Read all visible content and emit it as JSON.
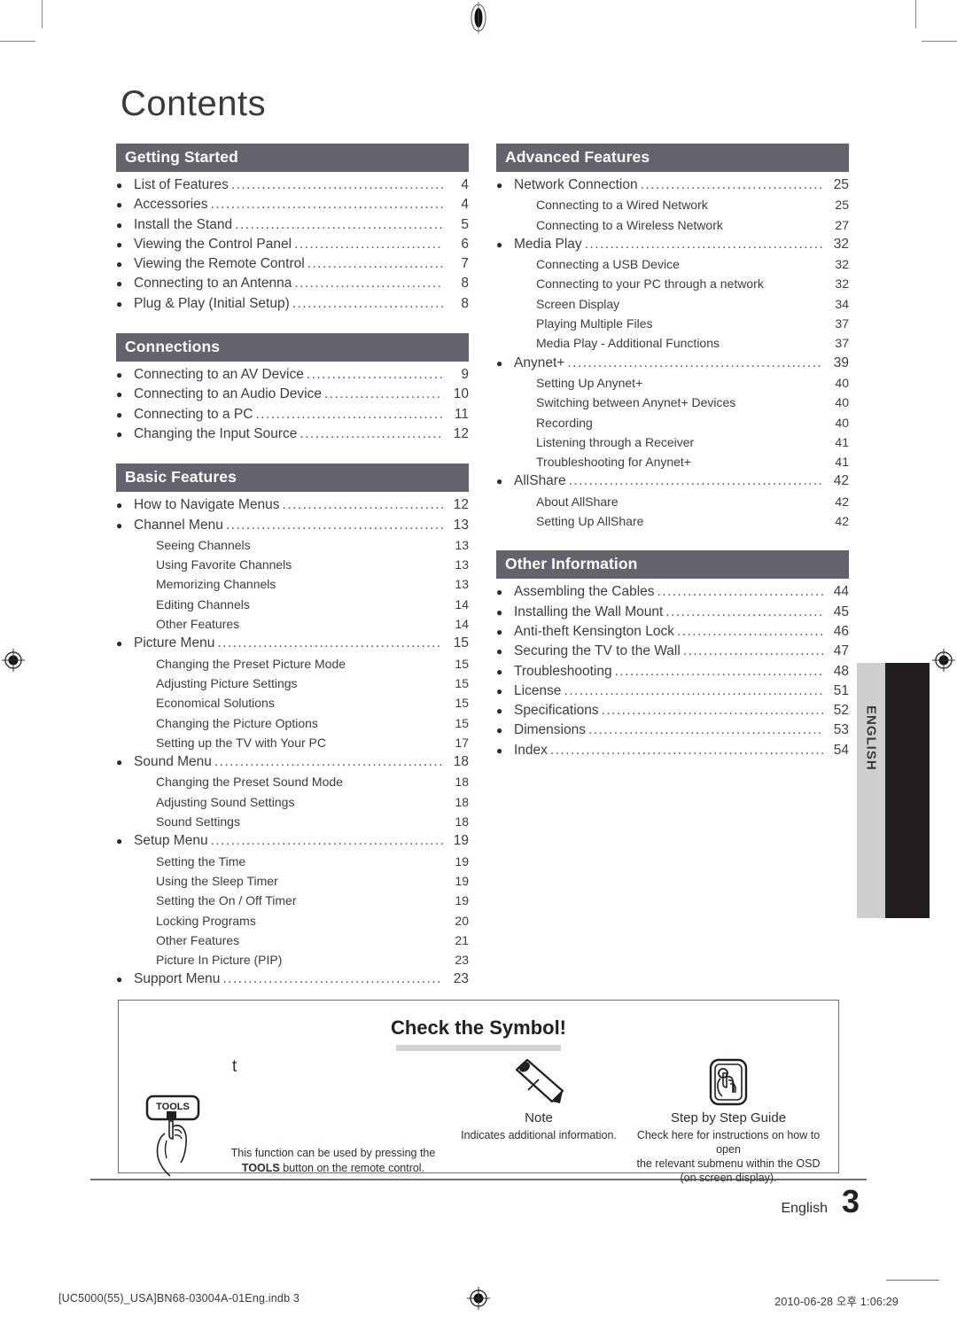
{
  "page": {
    "title": "Contents",
    "language_tab": "ENGLISH",
    "page_number": "3",
    "page_number_language": "English",
    "footer_left": "[UC5000(55)_USA]BN68-03004A-01Eng.indb   3",
    "footer_right": "2010-06-28   오후 1:06:29",
    "accent_bar_color": "#63636e",
    "tab_black_color": "#231f20",
    "tab_grey_color": "#cfcfd1"
  },
  "columns": {
    "left": [
      {
        "heading": "Getting Started",
        "entries": [
          {
            "level": 1,
            "title": "List of Features",
            "page": "4"
          },
          {
            "level": 1,
            "title": "Accessories",
            "page": "4"
          },
          {
            "level": 1,
            "title": "Install the Stand",
            "page": "5"
          },
          {
            "level": 1,
            "title": "Viewing the Control Panel",
            "page": "6"
          },
          {
            "level": 1,
            "title": "Viewing the Remote Control",
            "page": "7"
          },
          {
            "level": 1,
            "title": "Connecting to an Antenna",
            "page": "8"
          },
          {
            "level": 1,
            "title": "Plug & Play (Initial Setup)",
            "page": "8"
          }
        ]
      },
      {
        "heading": "Connections",
        "entries": [
          {
            "level": 1,
            "title": "Connecting to an AV Device",
            "page": "9"
          },
          {
            "level": 1,
            "title": "Connecting to an Audio Device",
            "page": "10"
          },
          {
            "level": 1,
            "title": "Connecting to a PC",
            "page": "11"
          },
          {
            "level": 1,
            "title": "Changing the Input Source",
            "page": "12"
          }
        ]
      },
      {
        "heading": "Basic Features",
        "entries": [
          {
            "level": 1,
            "title": "How to Navigate Menus",
            "page": "12"
          },
          {
            "level": 1,
            "title": "Channel Menu",
            "page": "13"
          },
          {
            "level": 2,
            "title": "Seeing Channels",
            "page": "13"
          },
          {
            "level": 2,
            "title": "Using Favorite Channels",
            "page": "13"
          },
          {
            "level": 2,
            "title": "Memorizing Channels",
            "page": "13"
          },
          {
            "level": 2,
            "title": "Editing Channels",
            "page": "14"
          },
          {
            "level": 2,
            "title": "Other Features",
            "page": "14"
          },
          {
            "level": 1,
            "title": "Picture Menu",
            "page": "15"
          },
          {
            "level": 2,
            "title": "Changing the Preset Picture Mode",
            "page": "15"
          },
          {
            "level": 2,
            "title": "Adjusting Picture Settings",
            "page": "15"
          },
          {
            "level": 2,
            "title": "Economical Solutions",
            "page": "15"
          },
          {
            "level": 2,
            "title": "Changing the Picture Options",
            "page": "15"
          },
          {
            "level": 2,
            "title": "Setting up the TV with Your PC",
            "page": "17"
          },
          {
            "level": 1,
            "title": "Sound Menu",
            "page": "18"
          },
          {
            "level": 2,
            "title": "Changing the Preset Sound Mode",
            "page": "18"
          },
          {
            "level": 2,
            "title": "Adjusting Sound Settings",
            "page": "18"
          },
          {
            "level": 2,
            "title": "Sound Settings",
            "page": "18"
          },
          {
            "level": 1,
            "title": "Setup Menu",
            "page": "19"
          },
          {
            "level": 2,
            "title": "Setting the Time",
            "page": "19"
          },
          {
            "level": 2,
            "title": "Using the Sleep Timer",
            "page": "19"
          },
          {
            "level": 2,
            "title": "Setting the On / Off Timer",
            "page": "19"
          },
          {
            "level": 2,
            "title": "Locking Programs",
            "page": "20"
          },
          {
            "level": 2,
            "title": "Other Features",
            "page": "21"
          },
          {
            "level": 2,
            "title": "Picture In Picture (PIP)",
            "page": "23"
          },
          {
            "level": 1,
            "title": "Support Menu",
            "page": "23"
          }
        ]
      }
    ],
    "right": [
      {
        "heading": "Advanced Features",
        "entries": [
          {
            "level": 1,
            "title": "Network Connection",
            "page": "25"
          },
          {
            "level": 2,
            "title": "Connecting to a Wired Network",
            "page": "25"
          },
          {
            "level": 2,
            "title": "Connecting to a Wireless Network",
            "page": "27"
          },
          {
            "level": 1,
            "title": "Media Play",
            "page": "32"
          },
          {
            "level": 2,
            "title": "Connecting a USB Device",
            "page": "32"
          },
          {
            "level": 2,
            "title": "Connecting to your PC through a network",
            "page": "32"
          },
          {
            "level": 2,
            "title": "Screen Display",
            "page": "34"
          },
          {
            "level": 2,
            "title": "Playing Multiple Files",
            "page": "37"
          },
          {
            "level": 2,
            "title": "Media Play - Additional Functions",
            "page": "37"
          },
          {
            "level": 1,
            "title": "Anynet+",
            "page": "39"
          },
          {
            "level": 2,
            "title": "Setting Up Anynet+",
            "page": "40"
          },
          {
            "level": 2,
            "title": "Switching between Anynet+ Devices",
            "page": "40"
          },
          {
            "level": 2,
            "title": "Recording",
            "page": "40"
          },
          {
            "level": 2,
            "title": "Listening through a Receiver",
            "page": "41"
          },
          {
            "level": 2,
            "title": "Troubleshooting for Anynet+",
            "page": "41"
          },
          {
            "level": 1,
            "title": "AllShare",
            "page": "42"
          },
          {
            "level": 2,
            "title": "About AllShare",
            "page": "42"
          },
          {
            "level": 2,
            "title": "Setting Up AllShare",
            "page": "42"
          }
        ]
      },
      {
        "heading": "Other Information",
        "entries": [
          {
            "level": 1,
            "title": "Assembling the Cables",
            "page": "44"
          },
          {
            "level": 1,
            "title": "Installing the Wall Mount",
            "page": "45"
          },
          {
            "level": 1,
            "title": "Anti-theft Kensington Lock",
            "page": "46"
          },
          {
            "level": 1,
            "title": "Securing the TV to the Wall",
            "page": "47"
          },
          {
            "level": 1,
            "title": "Troubleshooting",
            "page": "48"
          },
          {
            "level": 1,
            "title": "License",
            "page": "51"
          },
          {
            "level": 1,
            "title": "Specifications",
            "page": "52"
          },
          {
            "level": 1,
            "title": "Dimensions",
            "page": "53"
          },
          {
            "level": 1,
            "title": "Index",
            "page": "54"
          }
        ]
      }
    ]
  },
  "symbol_box": {
    "title": "Check the Symbol!",
    "items": [
      {
        "icon": "tools-button-icon",
        "glyph": "t",
        "caption": "",
        "desc_line1": "This function can be used by pressing the",
        "desc_line2_bold": "TOOLS",
        "desc_line2_rest": " button on the remote control.",
        "button_label": "TOOLS"
      },
      {
        "icon": "pencil-note-icon",
        "caption": "Note",
        "desc": "Indicates additional information."
      },
      {
        "icon": "step-by-step-guide-icon",
        "caption": "Step by Step Guide",
        "desc_line1": "Check here for instructions on how to open",
        "desc_line2": "the relevant submenu within the OSD",
        "desc_line3": "(on screen display)."
      }
    ]
  }
}
